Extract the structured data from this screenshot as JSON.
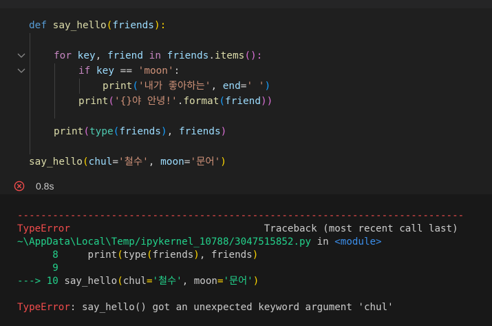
{
  "cell": {
    "exec_time": "0.8s",
    "status_icon": "error-circle-icon"
  },
  "code_lines": [
    {
      "tokens": [
        [
          "def",
          "k"
        ],
        [
          " ",
          "p"
        ],
        [
          "say_hello",
          "f"
        ],
        [
          "(",
          "y"
        ],
        [
          "friends",
          "v"
        ],
        [
          "):",
          "y"
        ]
      ]
    },
    {
      "tokens": []
    },
    {
      "tokens": [
        [
          "for",
          "c"
        ],
        [
          " ",
          "p"
        ],
        [
          "key",
          "v"
        ],
        [
          ", ",
          "p"
        ],
        [
          "friend",
          "v"
        ],
        [
          " ",
          "p"
        ],
        [
          "in",
          "c"
        ],
        [
          " ",
          "p"
        ],
        [
          "friends",
          "v"
        ],
        [
          ".",
          "p"
        ],
        [
          "items",
          "f"
        ],
        [
          "():",
          "m"
        ]
      ]
    },
    {
      "tokens": [
        [
          "if",
          "c"
        ],
        [
          " ",
          "p"
        ],
        [
          "key",
          "v"
        ],
        [
          " == ",
          "p"
        ],
        [
          "'moon'",
          "s"
        ],
        [
          ":",
          "p"
        ]
      ]
    },
    {
      "tokens": [
        [
          "print",
          "f"
        ],
        [
          "(",
          "n"
        ],
        [
          "'내가 좋아하는'",
          "s"
        ],
        [
          ", ",
          "p"
        ],
        [
          "end",
          "v"
        ],
        [
          "=",
          "p"
        ],
        [
          "' '",
          "s"
        ],
        [
          ")",
          "n"
        ]
      ]
    },
    {
      "tokens": [
        [
          "print",
          "f"
        ],
        [
          "(",
          "m"
        ],
        [
          "'{}야 안녕!'",
          "s"
        ],
        [
          ".",
          "p"
        ],
        [
          "format",
          "f"
        ],
        [
          "(",
          "n"
        ],
        [
          "friend",
          "v"
        ],
        [
          "))",
          "m"
        ]
      ]
    },
    {
      "tokens": []
    },
    {
      "tokens": [
        [
          "print",
          "f"
        ],
        [
          "(",
          "m"
        ],
        [
          "type",
          "b"
        ],
        [
          "(",
          "n"
        ],
        [
          "friends",
          "v"
        ],
        [
          ")",
          "n"
        ],
        [
          ", ",
          "p"
        ],
        [
          "friends",
          "v"
        ],
        [
          ")",
          "m"
        ]
      ]
    },
    {
      "tokens": []
    },
    {
      "tokens": [
        [
          "say_hello",
          "f"
        ],
        [
          "(",
          "y"
        ],
        [
          "chul",
          "v"
        ],
        [
          "=",
          "p"
        ],
        [
          "'철수'",
          "s"
        ],
        [
          ", ",
          "p"
        ],
        [
          "moon",
          "v"
        ],
        [
          "=",
          "p"
        ],
        [
          "'문어'",
          "s"
        ],
        [
          ")",
          "y"
        ]
      ]
    }
  ],
  "output_lines": [
    {
      "tokens": [
        [
          "----------------------------------------------------------------------------",
          "red"
        ]
      ]
    },
    {
      "tokens": [
        [
          "TypeError",
          "red"
        ],
        [
          "                                 Traceback (most recent call last)",
          ""
        ]
      ]
    },
    {
      "tokens": [
        [
          "~\\AppData\\Local\\Temp/ipykernel_10788/3047515852.py",
          "grn"
        ],
        [
          " in ",
          ""
        ],
        [
          "<module>",
          "blu"
        ]
      ]
    },
    {
      "tokens": [
        [
          "      8 ",
          "grn"
        ],
        [
          "    print",
          ""
        ],
        [
          "(",
          "y"
        ],
        [
          "type",
          ""
        ],
        [
          "(",
          "y"
        ],
        [
          "friends",
          ""
        ],
        [
          ")",
          "y"
        ],
        [
          ", friends",
          ""
        ],
        [
          ")",
          "y"
        ]
      ]
    },
    {
      "tokens": [
        [
          "      9",
          "grn"
        ]
      ]
    },
    {
      "tokens": [
        [
          "---> 10 ",
          "grn"
        ],
        [
          "say_hello",
          ""
        ],
        [
          "(",
          "y"
        ],
        [
          "chul",
          ""
        ],
        [
          "=",
          "y"
        ],
        [
          "'철수'",
          "grn"
        ],
        [
          ", moon",
          ""
        ],
        [
          "=",
          "y"
        ],
        [
          "'문어'",
          "grn"
        ],
        [
          ")",
          "y"
        ]
      ]
    },
    {
      "tokens": []
    },
    {
      "tokens": [
        [
          "TypeError",
          "red"
        ],
        [
          ": say_hello() got an unexpected keyword argument 'chul'",
          ""
        ]
      ]
    }
  ]
}
